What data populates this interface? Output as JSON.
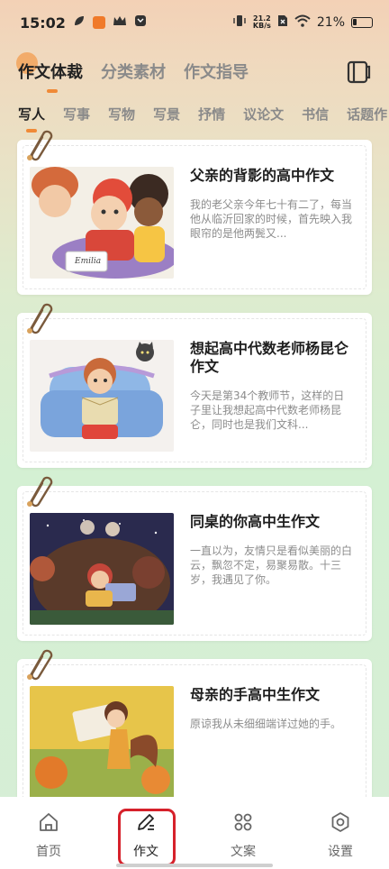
{
  "status": {
    "time": "15:02",
    "net_speed_value": "21.2",
    "net_speed_unit": "KB/s",
    "battery": "21%"
  },
  "top_tabs": [
    {
      "label": "作文体裁",
      "active": true
    },
    {
      "label": "分类素材",
      "active": false
    },
    {
      "label": "作文指导",
      "active": false
    }
  ],
  "category_tabs": [
    {
      "label": "写人",
      "active": true
    },
    {
      "label": "写事",
      "active": false
    },
    {
      "label": "写物",
      "active": false
    },
    {
      "label": "写景",
      "active": false
    },
    {
      "label": "抒情",
      "active": false
    },
    {
      "label": "议论文",
      "active": false
    },
    {
      "label": "书信",
      "active": false
    },
    {
      "label": "话题作",
      "active": false
    }
  ],
  "articles": [
    {
      "title": "父亲的背影的高中作文",
      "excerpt": "我的老父亲今年七十有二了，每当他从临沂回家的时候，首先映入我眼帘的是他两鬓又...",
      "image": "children-illustration",
      "image_caption": "Emilia"
    },
    {
      "title": "想起高中代数老师杨昆仑作文",
      "excerpt": "今天是第34个教师节，这样的日子里让我想起高中代数老师杨昆仑，同时也是我们文科...",
      "image": "girl-reading-armchair-illustration"
    },
    {
      "title": "同桌的你高中生作文",
      "excerpt": "一直以为，友情只是看似美丽的白云，飘忽不定，易聚易散。十三岁，我遇见了你。",
      "image": "girl-reading-bears-illustration"
    },
    {
      "title": "母亲的手高中生作文",
      "excerpt": "原谅我从未细细端详过她的手。",
      "image": "girl-squirrel-tail-illustration"
    }
  ],
  "bottom_nav": [
    {
      "label": "首页",
      "icon": "home-icon",
      "active": false
    },
    {
      "label": "作文",
      "icon": "pencil-icon",
      "active": true
    },
    {
      "label": "文案",
      "icon": "grid-icon",
      "active": false
    },
    {
      "label": "设置",
      "icon": "settings-icon",
      "active": false
    }
  ],
  "colors": {
    "accent": "#f08a37",
    "highlight": "#d6212b"
  }
}
